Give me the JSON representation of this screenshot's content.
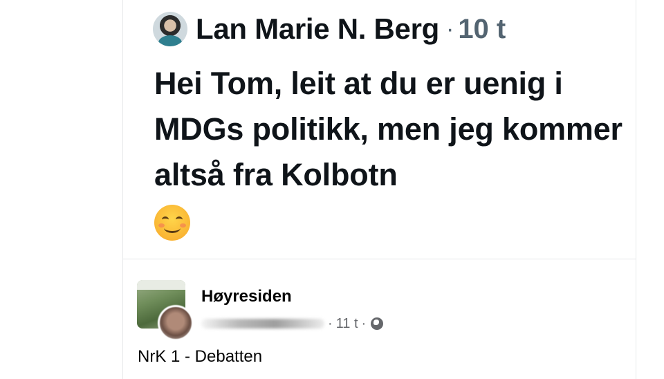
{
  "tweet": {
    "author_name": "Lan Marie N. Berg",
    "separator": "·",
    "timestamp": "10 t",
    "text": "Hei Tom, leit at du er uenig i MDGs politikk, men jeg kommer altså fra Kolbotn",
    "emoji": "smiling-face-emoji"
  },
  "facebook_post": {
    "page_name": "Høyresiden",
    "timestamp": "11 t",
    "separator": "·",
    "audience_icon": "globe-icon",
    "text": "NrK 1 - Debatten"
  }
}
